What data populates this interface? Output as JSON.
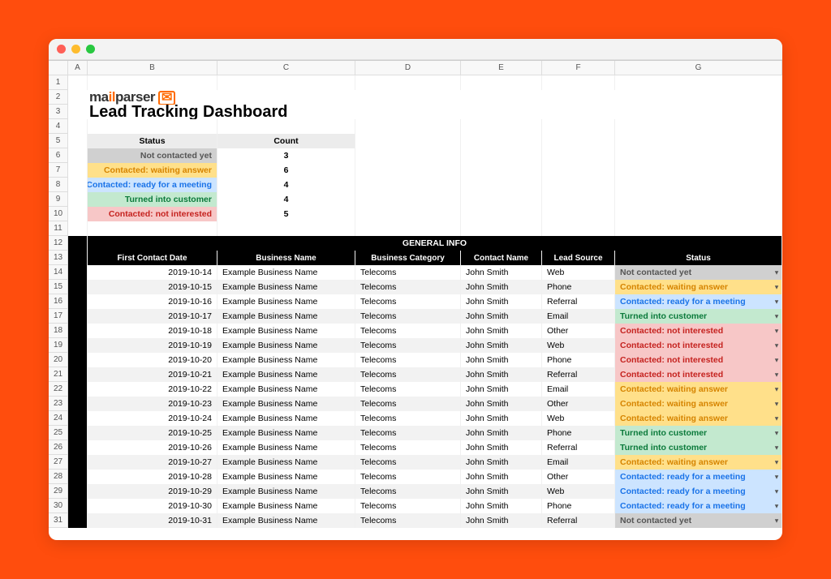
{
  "window": {
    "title": "Lead Tracking Dashboard"
  },
  "logo": {
    "pre": "ma",
    "mid": "il",
    "post": "parser"
  },
  "columns": [
    "A",
    "B",
    "C",
    "D",
    "E",
    "F",
    "G"
  ],
  "row_numbers": [
    "1",
    "2",
    "3",
    "4",
    "5",
    "6",
    "7",
    "8",
    "9",
    "10",
    "11",
    "12",
    "13",
    "14",
    "15",
    "16",
    "17",
    "18",
    "19",
    "20",
    "21",
    "22",
    "23",
    "24",
    "25",
    "26",
    "27",
    "28",
    "29",
    "30",
    "31"
  ],
  "summary": {
    "headers": {
      "status": "Status",
      "count": "Count"
    },
    "rows": [
      {
        "label": "Not contacted yet",
        "count": "3",
        "cls": "s-not"
      },
      {
        "label": "Contacted: waiting answer",
        "count": "6",
        "cls": "s-wait"
      },
      {
        "label": "Contacted: ready for a meeting",
        "count": "4",
        "cls": "s-ready"
      },
      {
        "label": "Turned into customer",
        "count": "4",
        "cls": "s-cust"
      },
      {
        "label": "Contacted: not interested",
        "count": "5",
        "cls": "s-noint"
      }
    ]
  },
  "section_title": "GENERAL INFO",
  "table_headers": [
    "First Contact Date",
    "Business Name",
    "Business Category",
    "Contact Name",
    "Lead Source",
    "Status"
  ],
  "rows": [
    {
      "date": "2019-10-14",
      "biz": "Example Business Name",
      "cat": "Telecoms",
      "contact": "John Smith",
      "source": "Web",
      "status": "Not contacted yet",
      "cls": "s-not"
    },
    {
      "date": "2019-10-15",
      "biz": "Example Business Name",
      "cat": "Telecoms",
      "contact": "John Smith",
      "source": "Phone",
      "status": "Contacted: waiting answer",
      "cls": "s-wait"
    },
    {
      "date": "2019-10-16",
      "biz": "Example Business Name",
      "cat": "Telecoms",
      "contact": "John Smith",
      "source": "Referral",
      "status": "Contacted: ready for a meeting",
      "cls": "s-ready"
    },
    {
      "date": "2019-10-17",
      "biz": "Example Business Name",
      "cat": "Telecoms",
      "contact": "John Smith",
      "source": "Email",
      "status": "Turned into customer",
      "cls": "s-cust"
    },
    {
      "date": "2019-10-18",
      "biz": "Example Business Name",
      "cat": "Telecoms",
      "contact": "John Smith",
      "source": "Other",
      "status": "Contacted: not interested",
      "cls": "s-noint"
    },
    {
      "date": "2019-10-19",
      "biz": "Example Business Name",
      "cat": "Telecoms",
      "contact": "John Smith",
      "source": "Web",
      "status": "Contacted: not interested",
      "cls": "s-noint"
    },
    {
      "date": "2019-10-20",
      "biz": "Example Business Name",
      "cat": "Telecoms",
      "contact": "John Smith",
      "source": "Phone",
      "status": "Contacted: not interested",
      "cls": "s-noint"
    },
    {
      "date": "2019-10-21",
      "biz": "Example Business Name",
      "cat": "Telecoms",
      "contact": "John Smith",
      "source": "Referral",
      "status": "Contacted: not interested",
      "cls": "s-noint"
    },
    {
      "date": "2019-10-22",
      "biz": "Example Business Name",
      "cat": "Telecoms",
      "contact": "John Smith",
      "source": "Email",
      "status": "Contacted: waiting answer",
      "cls": "s-wait"
    },
    {
      "date": "2019-10-23",
      "biz": "Example Business Name",
      "cat": "Telecoms",
      "contact": "John Smith",
      "source": "Other",
      "status": "Contacted: waiting answer",
      "cls": "s-wait"
    },
    {
      "date": "2019-10-24",
      "biz": "Example Business Name",
      "cat": "Telecoms",
      "contact": "John Smith",
      "source": "Web",
      "status": "Contacted: waiting answer",
      "cls": "s-wait"
    },
    {
      "date": "2019-10-25",
      "biz": "Example Business Name",
      "cat": "Telecoms",
      "contact": "John Smith",
      "source": "Phone",
      "status": "Turned into customer",
      "cls": "s-cust"
    },
    {
      "date": "2019-10-26",
      "biz": "Example Business Name",
      "cat": "Telecoms",
      "contact": "John Smith",
      "source": "Referral",
      "status": "Turned into customer",
      "cls": "s-cust"
    },
    {
      "date": "2019-10-27",
      "biz": "Example Business Name",
      "cat": "Telecoms",
      "contact": "John Smith",
      "source": "Email",
      "status": "Contacted: waiting answer",
      "cls": "s-wait"
    },
    {
      "date": "2019-10-28",
      "biz": "Example Business Name",
      "cat": "Telecoms",
      "contact": "John Smith",
      "source": "Other",
      "status": "Contacted: ready for a meeting",
      "cls": "s-ready"
    },
    {
      "date": "2019-10-29",
      "biz": "Example Business Name",
      "cat": "Telecoms",
      "contact": "John Smith",
      "source": "Web",
      "status": "Contacted: ready for a meeting",
      "cls": "s-ready"
    },
    {
      "date": "2019-10-30",
      "biz": "Example Business Name",
      "cat": "Telecoms",
      "contact": "John Smith",
      "source": "Phone",
      "status": "Contacted: ready for a meeting",
      "cls": "s-ready"
    },
    {
      "date": "2019-10-31",
      "biz": "Example Business Name",
      "cat": "Telecoms",
      "contact": "John Smith",
      "source": "Referral",
      "status": "Not contacted yet",
      "cls": "s-not"
    }
  ]
}
